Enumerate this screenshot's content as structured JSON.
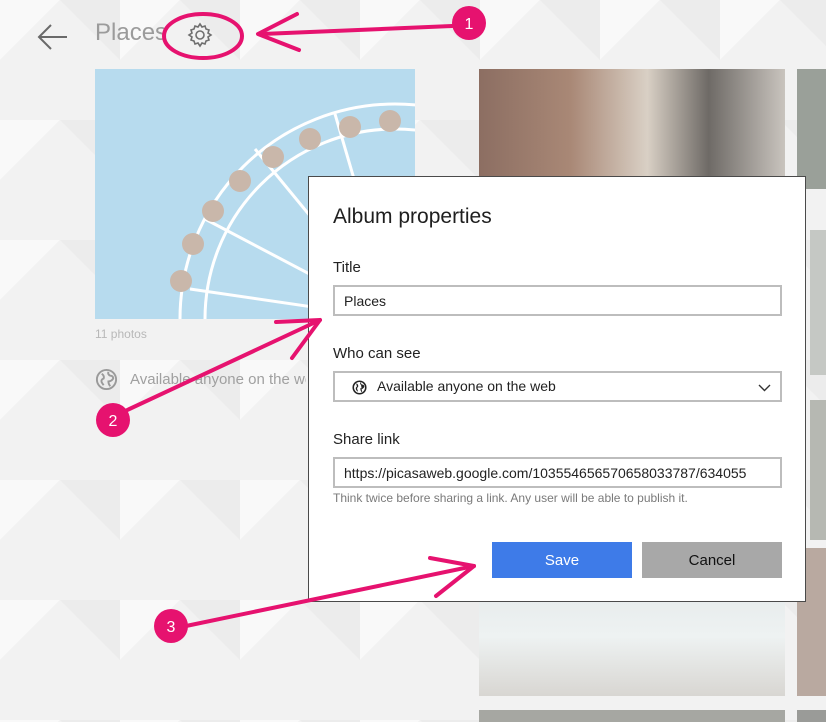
{
  "header": {
    "title": "Places",
    "back_icon": "arrow-left-icon",
    "settings_icon": "gear-icon"
  },
  "album": {
    "photo_count": "11 photos",
    "visibility": "Available anyone on the web",
    "visibility_icon": "globe-icon"
  },
  "dialog": {
    "title": "Album properties",
    "title_label": "Title",
    "title_value": "Places",
    "who_label": "Who can see",
    "who_value": "Available anyone on the web",
    "share_label": "Share link",
    "share_value": "https://picasaweb.google.com/103554656570658033787/634055",
    "share_hint": "Think twice before sharing a link. Any user will be able to publish it.",
    "save_label": "Save",
    "cancel_label": "Cancel"
  },
  "annotations": {
    "badges": [
      "1",
      "2",
      "3"
    ],
    "color": "#e6126f"
  },
  "colors": {
    "accent": "#3e7be8",
    "cancel": "#a8a8a8",
    "annotation": "#e6126f"
  }
}
